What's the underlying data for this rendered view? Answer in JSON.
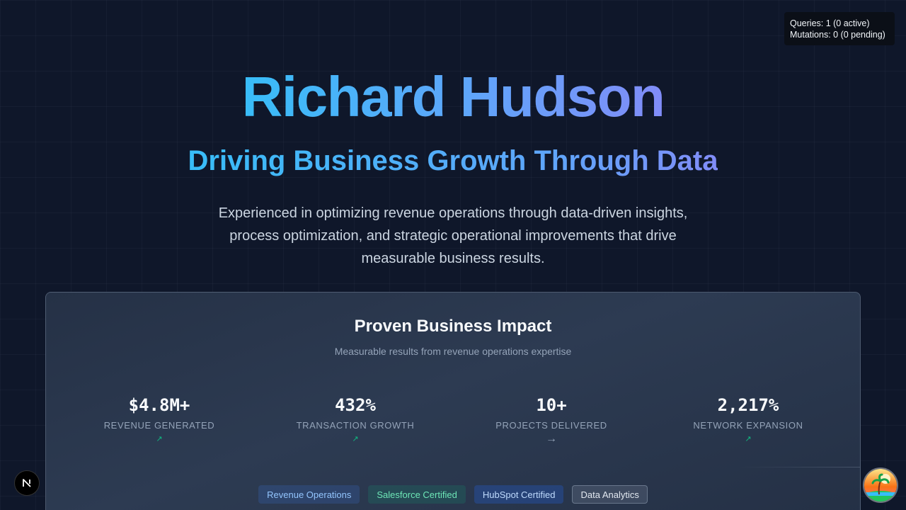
{
  "devtools": {
    "queries": "Queries: 1 (0 active)",
    "mutations": "Mutations: 0 (0 pending)"
  },
  "hero": {
    "name": "Richard Hudson",
    "tagline": "Driving Business Growth Through Data",
    "description": "Experienced in optimizing revenue operations through data-driven insights, process optimization, and strategic operational improvements that drive measurable business results."
  },
  "impact": {
    "title": "Proven Business Impact",
    "subtitle": "Measurable results from revenue operations expertise",
    "stats": [
      {
        "value": "$4.8M+",
        "label": "REVENUE GENERATED",
        "trend": "↗"
      },
      {
        "value": "432%",
        "label": "TRANSACTION GROWTH",
        "trend": "↗"
      },
      {
        "value": "10+",
        "label": "PROJECTS DELIVERED",
        "trend": "→"
      },
      {
        "value": "2,217%",
        "label": "NETWORK EXPANSION",
        "trend": "↗"
      }
    ],
    "tags": [
      "Revenue Operations",
      "Salesforce Certified",
      "HubSpot Certified",
      "Data Analytics"
    ]
  },
  "icons": {
    "next_devtools": "nextjs-logo-icon",
    "avatar": "beach-avatar-icon"
  },
  "colors": {
    "background": "#0f172a",
    "accent_start": "#38bdf8",
    "accent_end": "#818cf8",
    "trend_up": "#10b981"
  }
}
